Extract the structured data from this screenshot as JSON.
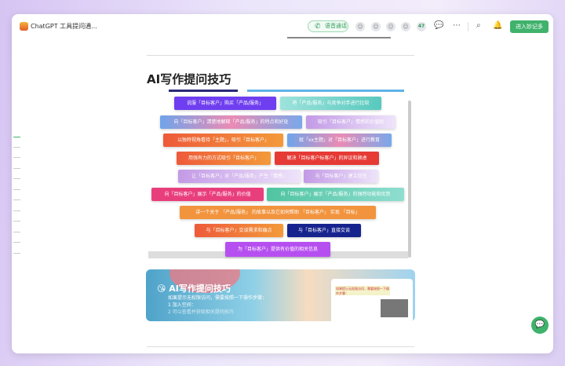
{
  "header": {
    "title": "ChatGPT 工具提问通...",
    "voice_call": "语音通话",
    "member_count": "47",
    "enter_button": "进入妙记多"
  },
  "article": {
    "heading": "AI写作提问技巧"
  },
  "buttons": [
    "说服「目标客户」购买「产品/服务」",
    "将「产品/服务」与竞争对手进行比较",
    "向「目标客户」清楚地解释「产品/服务」的特点和好处",
    "吸引「目标客户」情感和价值观",
    "以独特视角看待「主题」，吸引「目标客户」",
    "就「xx主题」对「目标客户」进行教育",
    "用强有力的方式吸引「目标客户」",
    "解决「目标客户标客户」的异议和顾虑",
    "让「目标客户」对「产品/服务」产生「情感」",
    "与「目标客户」建立信任",
    "向「目标客户」展示「产品/服务」的价值",
    "向「目标客户」展示「产品/服务」的独特功能和优势",
    "讲一个关于 「产品/服务」 的故事以及它如何帮助 「目标客户」 实现 「目标」",
    "与「目标客户」交谈需求和痛点",
    "与「目标客户」直接交谈",
    "为「目标客户」提供有价值的相关信息"
  ],
  "banner": {
    "title": "AI写作提问技巧",
    "line1": "如果提示无权限访问，需要按照一下操作步骤：",
    "line2": "1 加入空间：",
    "line3": "2 可以查看并获取相关提问技巧",
    "card_text": "如果提示无权限访问，需要按照一下操作步骤："
  },
  "colors": {
    "accent": "#3fb26b"
  }
}
